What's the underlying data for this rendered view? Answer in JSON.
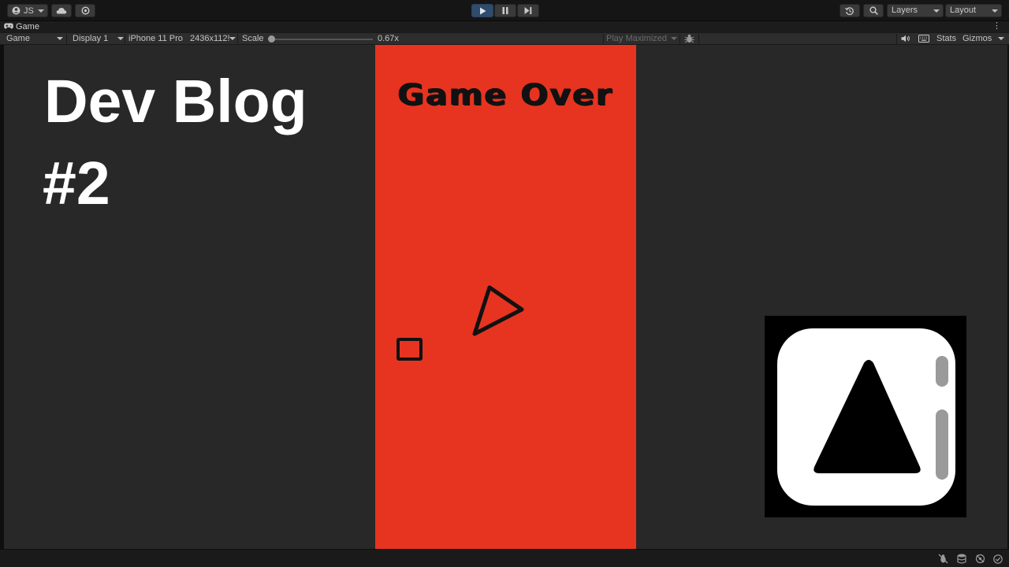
{
  "toolbar": {
    "account_label": "JS",
    "layers_label": "Layers",
    "layout_label": "Layout"
  },
  "tab": {
    "title": "Game",
    "menu_glyph": "⋮"
  },
  "game_bar": {
    "mode": "Game",
    "display": "Display 1",
    "device": "iPhone 11 Pro",
    "resolution": "2436x112!",
    "scale_label": "Scale",
    "scale_value": "0.67x",
    "play_mode": "Play Maximized",
    "stats": "Stats",
    "gizmos": "Gizmos"
  },
  "scale_slider_fraction": 0.0,
  "game": {
    "title": "Game Over",
    "background_color": "#e63420"
  },
  "overlay": {
    "title": "Dev Blog",
    "number": "#2"
  },
  "colors": {
    "play_accent": "#2f4b6e",
    "editor_bg": "#282828",
    "game_bg": "#e63420"
  },
  "icons": {
    "account": "account-icon",
    "cloud": "cloud-icon",
    "collab": "collab-icon",
    "play": "play-icon",
    "pause": "pause-icon",
    "step": "step-icon",
    "history": "history-icon",
    "search": "search-icon",
    "audio": "speaker-icon",
    "keyboard": "keyboard-icon",
    "bug": "bug-icon"
  }
}
